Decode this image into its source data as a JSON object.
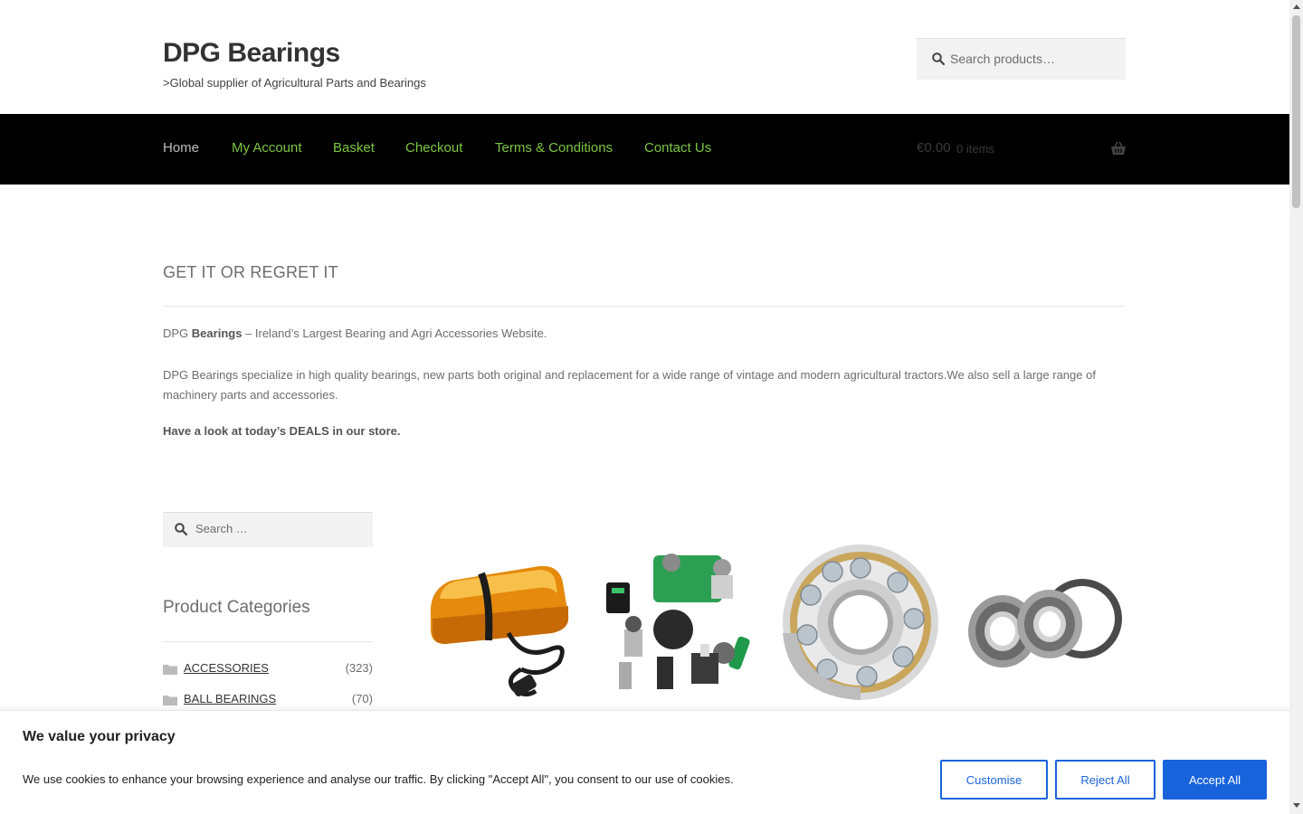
{
  "header": {
    "site_title": "DPG Bearings",
    "tagline": ">Global supplier of Agricultural Parts and Bearings",
    "search_placeholder": "Search products…"
  },
  "nav": {
    "items": [
      "Home",
      "My Account",
      "Basket",
      "Checkout",
      "Terms & Conditions",
      "Contact Us"
    ],
    "cart_total": "€0.00",
    "cart_count": "0 items"
  },
  "content": {
    "heading": "GET IT OR REGRET IT",
    "p1_prefix": "DPG ",
    "p1_bold": "Bearings",
    "p1_suffix": " – Ireland’s Largest Bearing and Agri Accessories Website.",
    "p2": "DPG Bearings specialize in high quality bearings, new parts both original and replacement for a wide range of vintage and modern agricultural tractors.We also sell a large range of machinery parts and accessories.",
    "p3": "Have a look at today’s DEALS in our store."
  },
  "sidebar": {
    "search_placeholder": "Search …",
    "categories_title": "Product Categories",
    "categories": [
      {
        "name": "ACCESSORIES",
        "count": "(323)"
      },
      {
        "name": "BALL BEARINGS",
        "count": "(70)"
      }
    ]
  },
  "products": [
    {
      "icon": "amber-beacon-light"
    },
    {
      "icon": "switches-assortment"
    },
    {
      "icon": "angular-contact-ball-bearing"
    },
    {
      "icon": "taper-bearings-with-seal"
    }
  ],
  "cookie": {
    "title": "We value your privacy",
    "text": "We use cookies to enhance your browsing experience and analyse our traffic. By clicking \"Accept All\", you consent to our use of cookies.",
    "customise": "Customise",
    "reject": "Reject All",
    "accept": "Accept All"
  },
  "colors": {
    "nav_bg": "#000000",
    "nav_link": "#7cc642",
    "accent_blue": "#1863dc"
  }
}
